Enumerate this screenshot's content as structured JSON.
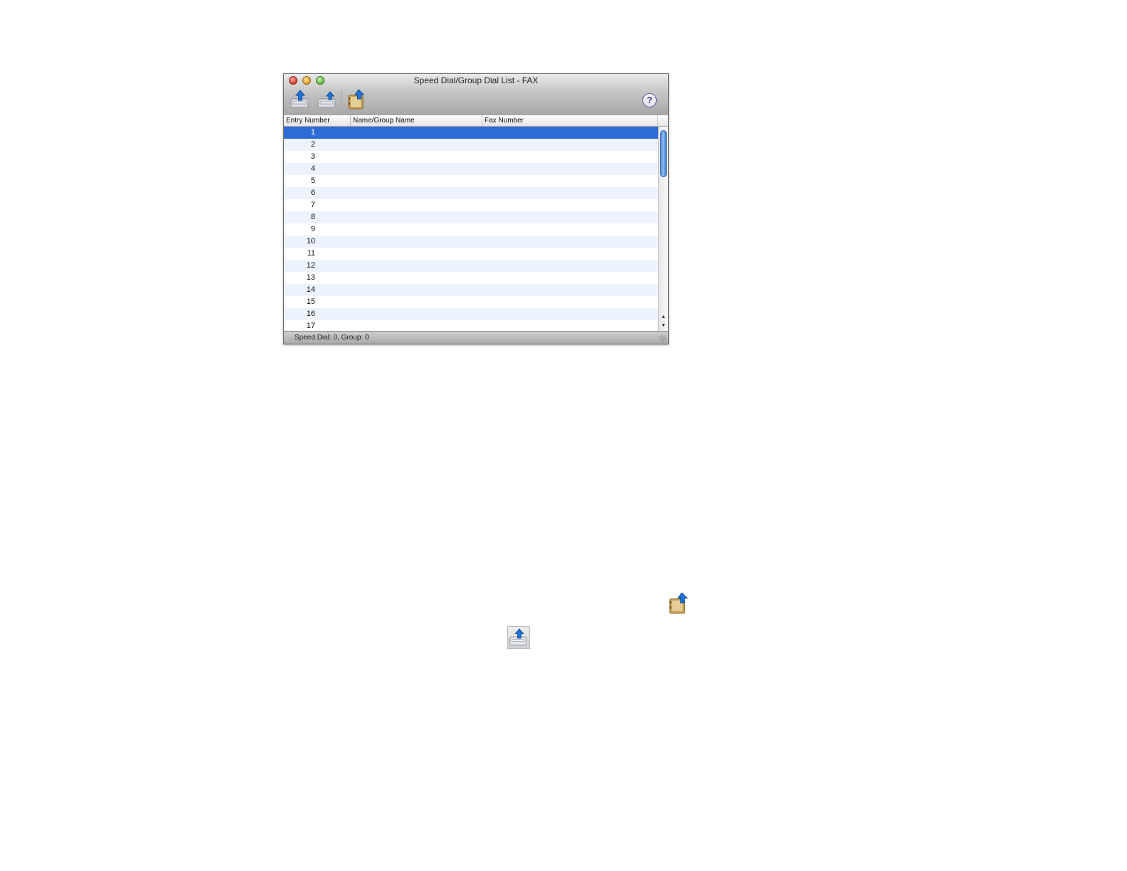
{
  "window": {
    "title": "Speed Dial/Group Dial List - FAX"
  },
  "toolbar": {
    "buttons": [
      {
        "icon": "fax-upload-icon"
      },
      {
        "icon": "fax-download-icon"
      },
      {
        "icon": "address-book-export-icon"
      }
    ],
    "help_icon": "help-icon",
    "help_label": "?"
  },
  "table": {
    "columns": [
      "Entry Number",
      "Name/Group Name",
      "Fax Number"
    ],
    "rows": [
      "1",
      "2",
      "3",
      "4",
      "5",
      "6",
      "7",
      "8",
      "9",
      "10",
      "11",
      "12",
      "13",
      "14",
      "15",
      "16",
      "17"
    ],
    "selected_row": 0
  },
  "status": {
    "text": "Speed Dial: 0, Group: 0"
  },
  "inline_icons": [
    {
      "icon": "address-book-export-icon"
    },
    {
      "icon": "fax-upload-icon"
    }
  ],
  "colors": {
    "selection": "#2f6dd5",
    "stripe": "#edf3fe",
    "arrow_blue": "#1e74d8",
    "book_tan": "#c9a15a"
  }
}
